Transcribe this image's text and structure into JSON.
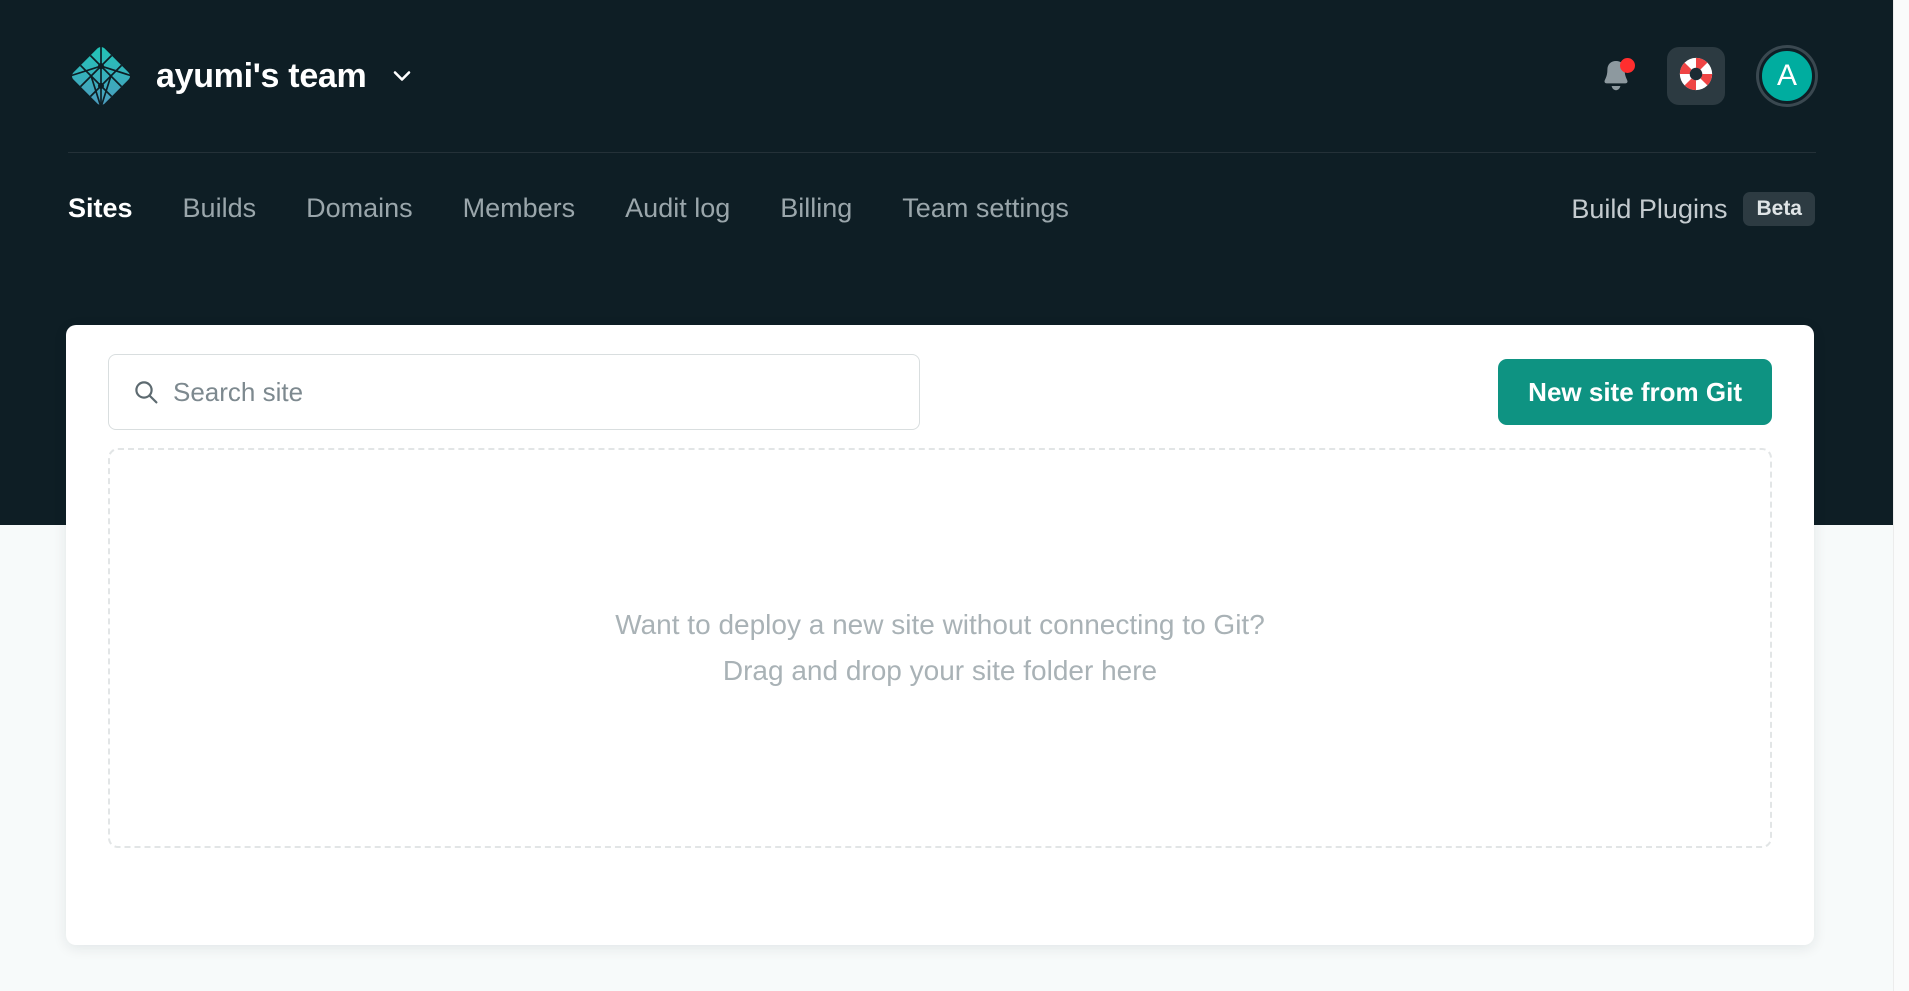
{
  "header": {
    "logo_icon": "netlify-diamond-logo",
    "team_name": "ayumi's team",
    "team_switcher_icon": "chevron-down-icon",
    "notifications_icon": "bell-icon",
    "notifications_badge": "unread-dot",
    "help_icon": "lifebuoy-icon",
    "avatar_initial": "A"
  },
  "nav": {
    "items": [
      {
        "label": "Sites",
        "active": true
      },
      {
        "label": "Builds",
        "active": false
      },
      {
        "label": "Domains",
        "active": false
      },
      {
        "label": "Members",
        "active": false
      },
      {
        "label": "Audit log",
        "active": false
      },
      {
        "label": "Billing",
        "active": false
      },
      {
        "label": "Team settings",
        "active": false
      }
    ],
    "plugins_label": "Build Plugins",
    "plugins_badge": "Beta"
  },
  "toolbar": {
    "search_icon": "search-icon",
    "search_value": "",
    "search_placeholder": "Search site",
    "new_site_label": "New site from Git"
  },
  "dropzone": {
    "line1": "Want to deploy a new site without connecting to Git?",
    "line2": "Drag and drop your site folder here"
  },
  "colors": {
    "header_bg": "#0e1e25",
    "page_bg": "#f7fafa",
    "accent_teal": "#0e9382",
    "avatar_teal": "#00ad9f",
    "badge_red": "#ff2e2e",
    "muted_text": "#9aa6ab"
  }
}
